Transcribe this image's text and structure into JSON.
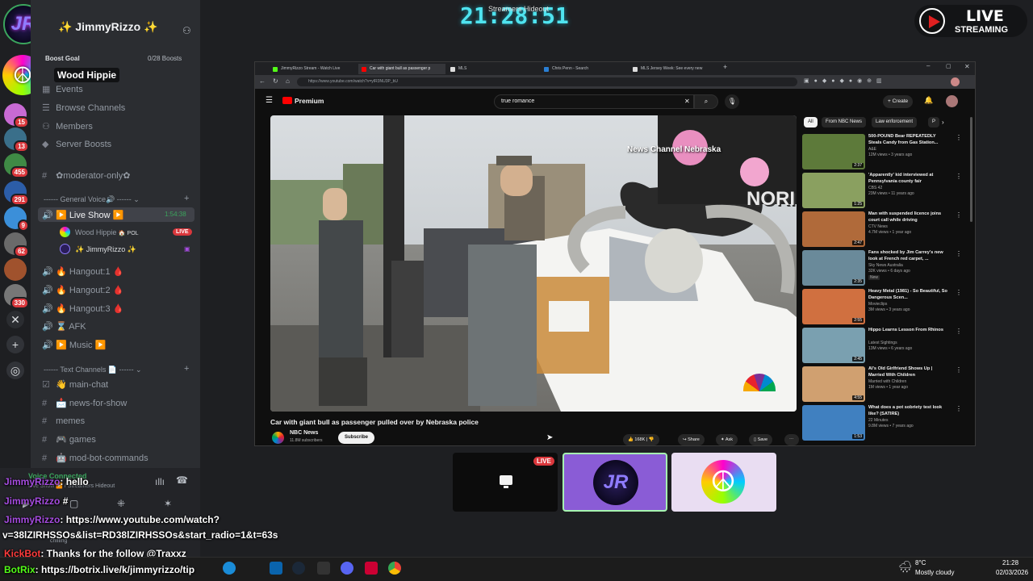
{
  "clock": "21:28:51",
  "stream_label": "Streamers Hideout",
  "live_badge": {
    "top": "LIVE",
    "bottom": "STREAMING"
  },
  "server": {
    "name": "✨ JimmyRizzo ✨",
    "hover_name": "Wood Hippie",
    "boost_goal": "Boost Goal",
    "boost_count": "0/28 Boosts",
    "nav": [
      "Events",
      "Browse Channels",
      "Members",
      "Server Boosts"
    ],
    "mod_channel": "✿moderator-only✿",
    "voice_category": "General Voice🔊",
    "live_channel": "▶️ Live Show ▶️",
    "live_timer": "1:54:38",
    "voice_users": [
      {
        "name": "Wood Hippie",
        "tag": "🏠 POL",
        "live": "LIVE"
      },
      {
        "name": "✨ JimmyRizzo ✨"
      }
    ],
    "voice_channels": [
      "🔥 Hangout:1 🩸",
      "🔥 Hangout:2 🩸",
      "🔥 Hangout:3 🩸",
      "⌛ AFK",
      "▶️ Music ▶️"
    ],
    "text_category": "Text Channels 📄",
    "text_channels": [
      "👋 main-chat",
      "📩 news-for-show",
      "memes",
      "🎮 games",
      "🤖 mod-bot-commands"
    ],
    "voice_connected": "Voice Connected",
    "voice_connected_sub": "Live Show ▶️ / Streamers Hideout",
    "user_status": "chilling",
    "guild_badges": [
      "15",
      "13",
      "455",
      "291",
      "9",
      "62",
      "330"
    ]
  },
  "chat": [
    {
      "name": "JimmyRizzo",
      "text": ": hello"
    },
    {
      "name": "JimmyRizzo",
      "text": " #"
    },
    {
      "name": "JimmyRizzo",
      "text": ": https://www.youtube.com/watch?"
    },
    {
      "name": "",
      "text": "v=38lZIRHSSOs&list=RD38lZIRHSSOs&start_radio=1&t=63s"
    },
    {
      "name": "KickBot",
      "text": ": Thanks for the follow @Traxxz"
    },
    {
      "name": "BotRix",
      "text": ": https://botrix.live/k/jimmyrizzo/tip"
    }
  ],
  "browser": {
    "tabs": [
      "JimmyRizzo Stream - Watch Live",
      "Car with giant bull as passenger p",
      "MLS",
      "Chris Penn - Search",
      "MLS Jersey Week: See every new"
    ],
    "url": "https://www.youtube.com/watch?v=yIR3NU3P_bU",
    "youtube": {
      "logo": "Premium",
      "search_value": "true romance",
      "create": "Create",
      "video_title": "Car with giant bull as passenger pulled over by Nebraska police",
      "watermark": "News Channel Nebraska",
      "sign_text": "NORI",
      "channel": "NBC News",
      "subscribers": "11.8M subscribers",
      "subscribe": "Subscribe",
      "actions": [
        "168K",
        "Share",
        "Ask",
        "Save"
      ],
      "chips": [
        "All",
        "From NBC News",
        "Law enforcement",
        "P"
      ],
      "recs": [
        {
          "title": "500-POUND Bear REPEATEDLY Steals Candy from Gas Station...",
          "channel": "A&E",
          "meta": "12M views • 3 years ago",
          "dur": "2:37"
        },
        {
          "title": "'Apparently' kid interviewed at Pennsylvania county fair",
          "channel": "CBS 42",
          "meta": "23M views • 11 years ago",
          "dur": "1:25"
        },
        {
          "title": "Man with suspended licence joins court call while driving",
          "channel": "CTV News",
          "meta": "4.7M views • 1 year ago",
          "dur": "2:47"
        },
        {
          "title": "Fans shocked by Jim Carrey's new look at French red carpet, ...",
          "channel": "Sky News Australia",
          "meta": "32K views • 6 days ago",
          "dur": "2:35",
          "badge": "New"
        },
        {
          "title": "Heavy Metal (1981) - So Beautiful, So Dangerous Scen...",
          "channel": "Movieclips",
          "meta": "3M views • 3 years ago",
          "dur": "2:55"
        },
        {
          "title": "Hippo Learns Lesson From Rhinos",
          "channel": "Latest Sightings",
          "meta": "13M views • 6 years ago",
          "dur": "2:45"
        },
        {
          "title": "AI's Old Girlfriend Shows Up | Married With Children",
          "channel": "Married with Children",
          "meta": "1M views • 1 year ago",
          "dur": "4:55"
        },
        {
          "title": "What does a pot sobriety test look like? (SATIRE)",
          "channel": "22 Minutes",
          "meta": "9.8M views • 7 years ago",
          "dur": "1:53"
        }
      ]
    }
  },
  "screens": {
    "live": "LIVE"
  },
  "weather": {
    "temp": "8°C",
    "desc": "Mostly cloudy"
  },
  "taskbar_time": "21:28",
  "taskbar_date": "02/03/2026",
  "colors": {
    "discord_dark": "#1e1f22",
    "discord_panel": "#2b2d31",
    "live_red": "#da373c",
    "clock_cyan": "#4fe3ef",
    "accent_purple": "#8a5cd6",
    "twitch_purple": "#a64ce0",
    "kick_green": "#53fc18"
  }
}
